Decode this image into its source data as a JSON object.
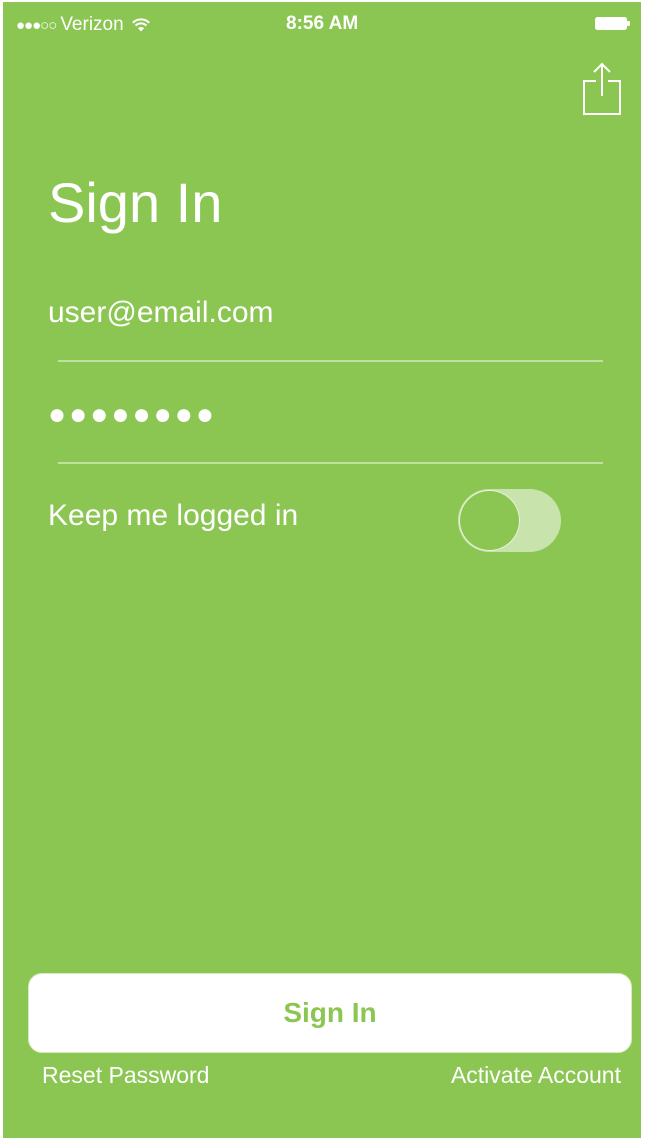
{
  "status_bar": {
    "signal": "●●●○○",
    "carrier": "Verizon",
    "time": "8:56 AM"
  },
  "icons": {
    "share": "share-icon",
    "wifi": "wifi-icon",
    "battery": "battery-icon"
  },
  "title": "Sign In",
  "form": {
    "email_value": "user@email.com",
    "password_value": "●●●●●●●●",
    "keep_logged_in_label": "Keep me logged in",
    "keep_logged_in": false
  },
  "sign_in_button_label": "Sign In",
  "links": {
    "reset_password": "Reset Password",
    "activate_account": "Activate Account"
  },
  "colors": {
    "background": "#8bc653",
    "accent_text": "#8bc653",
    "white": "#ffffff"
  }
}
